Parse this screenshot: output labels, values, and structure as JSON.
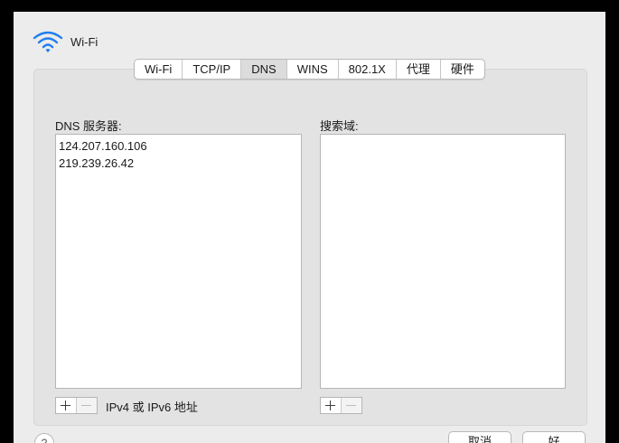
{
  "window": {
    "title": "Wi-Fi"
  },
  "tabs": [
    {
      "label": "Wi-Fi"
    },
    {
      "label": "TCP/IP"
    },
    {
      "label": "DNS"
    },
    {
      "label": "WINS"
    },
    {
      "label": "802.1X"
    },
    {
      "label": "代理"
    },
    {
      "label": "硬件"
    }
  ],
  "dns": {
    "label": "DNS 服务器:",
    "servers": [
      "124.207.160.106",
      "219.239.26.42"
    ],
    "hint": "IPv4 或 IPv6 地址"
  },
  "search": {
    "label": "搜索域:"
  },
  "footer": {
    "help": "?",
    "cancel": "取消",
    "ok": "好"
  },
  "icons": {
    "wifi": "wifi-icon",
    "add": "plus-icon",
    "remove": "minus-icon"
  }
}
